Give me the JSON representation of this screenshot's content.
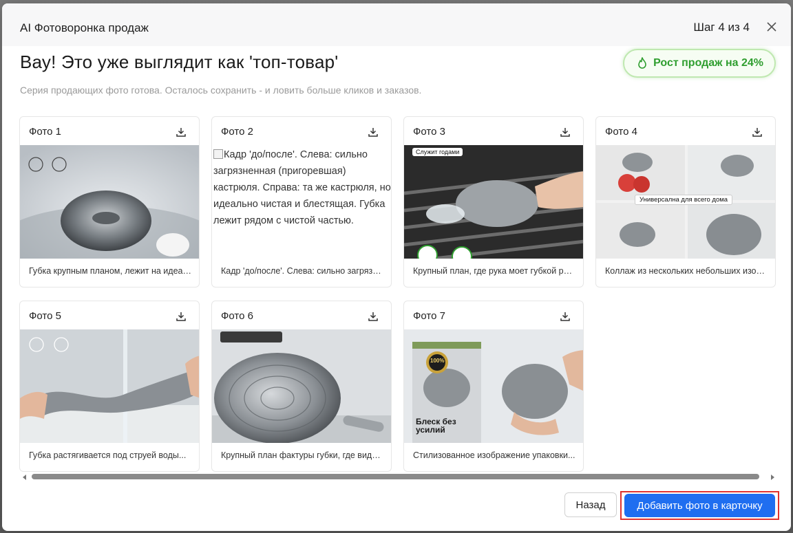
{
  "header": {
    "title": "AI Фотоворонка продаж",
    "step": "Шаг 4 из 4",
    "close_icon": "close-icon"
  },
  "main": {
    "headline": "Вау! Это уже выглядит как 'топ-товар'",
    "subline": "Серия продающих фото готова. Осталось сохранить - и ловить больше кликов и заказов.",
    "badge": {
      "text": "Рост продаж на 24%",
      "icon": "flame-icon",
      "color": "#2f9e2f"
    }
  },
  "photos": [
    {
      "title": "Фото 1",
      "caption": "Губка крупным планом, лежит на идеально чистой поверхности...",
      "overlay": ""
    },
    {
      "title": "Фото 2",
      "caption": "Кадр 'до/после'. Слева: сильно загрязненная (пригоревшая) кастрюля...",
      "alt": "Кадр 'до/после'. Слева: сильно загрязненная (пригоревшая) кастрюля. Справа: та же кастрюля, но идеально чистая и блестящая. Губка лежит рядом с чистой частью."
    },
    {
      "title": "Фото 3",
      "caption": "Крупный план, где рука моет губкой решетку гриля...",
      "overlay": "Служит годами"
    },
    {
      "title": "Фото 4",
      "caption": "Коллаж из нескольких небольших изображений...",
      "overlay": "Универсална для всего дома"
    },
    {
      "title": "Фото 5",
      "caption": "Губка растягивается под струей воды...",
      "overlay": ""
    },
    {
      "title": "Фото 6",
      "caption": "Крупный план фактуры губки, где видна...",
      "overlay": ""
    },
    {
      "title": "Фото 7",
      "caption": "Стилизованное изображение упаковки...",
      "overlay": "Блеск без усилий",
      "seal": "100%"
    }
  ],
  "footer": {
    "back_label": "Назад",
    "add_label": "Добавить фото в карточку"
  },
  "colors": {
    "accent": "#1f6ef0",
    "highlight_border": "#e0322e",
    "badge_green": "#2f9e2f"
  }
}
